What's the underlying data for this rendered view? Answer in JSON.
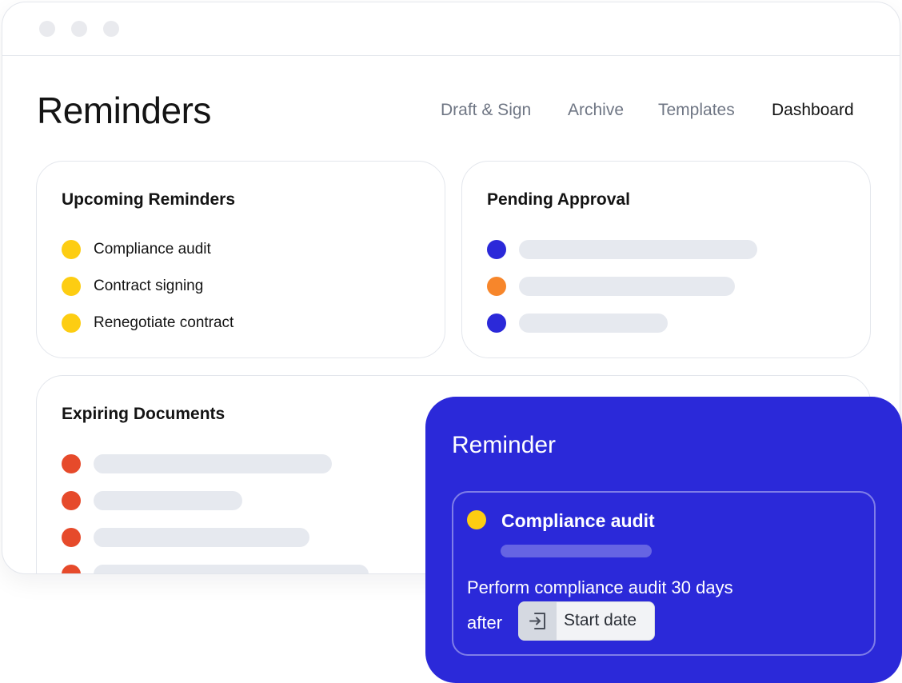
{
  "window": {
    "traffic_lights": [
      "#e9eaee",
      "#e9eaee",
      "#e9eaee"
    ]
  },
  "header": {
    "title": "Reminders",
    "nav": [
      {
        "label": "Draft & Sign",
        "active": false
      },
      {
        "label": "Archive",
        "active": false
      },
      {
        "label": "Templates",
        "active": false
      },
      {
        "label": "Dashboard",
        "active": true
      }
    ]
  },
  "colors": {
    "yellow": "#fdcd12",
    "blue": "#2b29d9",
    "orange": "#f7862b",
    "red": "#e64a2b",
    "placeholder_bar": "#e6e9ef"
  },
  "cards": {
    "upcoming": {
      "title": "Upcoming Reminders",
      "items": [
        {
          "label": "Compliance audit",
          "color": "#fdcd12"
        },
        {
          "label": "Contract signing",
          "color": "#fdcd12"
        },
        {
          "label": "Renegotiate contract",
          "color": "#fdcd12"
        }
      ]
    },
    "pending": {
      "title": "Pending Approval",
      "items": [
        {
          "color": "#2b29d9"
        },
        {
          "color": "#f7862b"
        },
        {
          "color": "#2b29d9"
        }
      ]
    },
    "expiring": {
      "title": "Expiring Documents",
      "items": [
        {
          "color": "#e64a2b"
        },
        {
          "color": "#e64a2b"
        },
        {
          "color": "#e64a2b"
        },
        {
          "color": "#e64a2b"
        }
      ]
    }
  },
  "reminder_popup": {
    "title": "Reminder",
    "item": {
      "title": "Compliance audit",
      "dot_color": "#fdcd12",
      "description_line1": "Perform compliance audit 30 days",
      "description_line2": "after",
      "chip_icon": "enter-icon",
      "chip_label": "Start date"
    }
  }
}
